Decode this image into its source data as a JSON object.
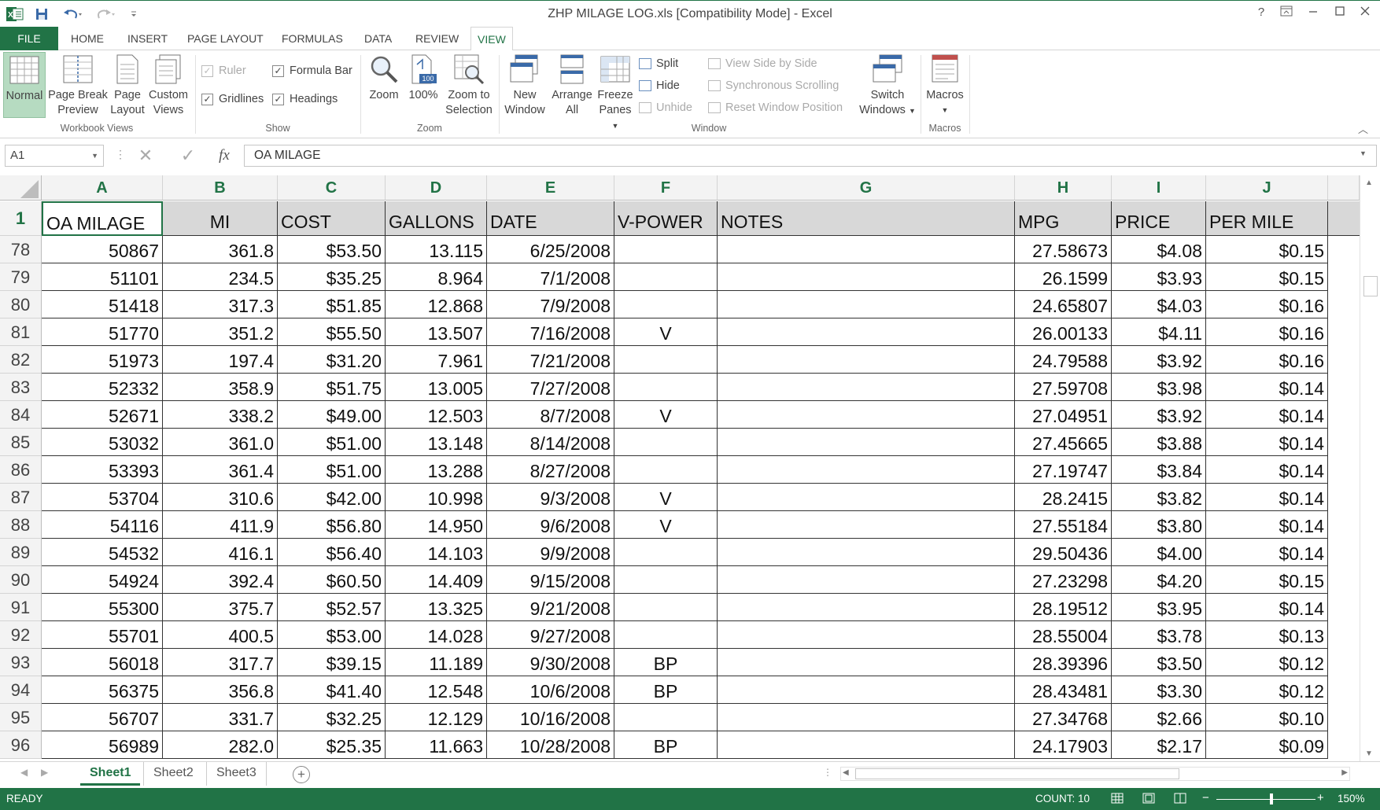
{
  "window": {
    "title": "ZHP MILAGE LOG.xls  [Compatibility Mode] - Excel",
    "help_label": "?",
    "accent": "#217346"
  },
  "ribbon_tabs": [
    "FILE",
    "HOME",
    "INSERT",
    "PAGE LAYOUT",
    "FORMULAS",
    "DATA",
    "REVIEW",
    "VIEW"
  ],
  "active_tab": "VIEW",
  "ribbon": {
    "workbook_views": {
      "label": "Workbook Views",
      "normal": "Normal",
      "page_break_1": "Page Break",
      "page_break_2": "Preview",
      "page_layout_1": "Page",
      "page_layout_2": "Layout",
      "custom_views_1": "Custom",
      "custom_views_2": "Views"
    },
    "show": {
      "label": "Show",
      "ruler": "Ruler",
      "formula_bar": "Formula Bar",
      "gridlines": "Gridlines",
      "headings": "Headings"
    },
    "zoom": {
      "label": "Zoom",
      "zoom": "Zoom",
      "hundred": "100%",
      "zoom_sel_1": "Zoom to",
      "zoom_sel_2": "Selection",
      "hundred_badge": "100"
    },
    "window": {
      "label": "Window",
      "new_window_1": "New",
      "new_window_2": "Window",
      "arrange_all_1": "Arrange",
      "arrange_all_2": "All",
      "freeze_1": "Freeze",
      "freeze_2": "Panes",
      "split": "Split",
      "hide": "Hide",
      "unhide": "Unhide",
      "view_side": "View Side by Side",
      "sync_scroll": "Synchronous Scrolling",
      "reset_pos": "Reset Window Position",
      "switch_1": "Switch",
      "switch_2": "Windows"
    },
    "macros": {
      "label": "Macros",
      "macros": "Macros"
    }
  },
  "formula_bar": {
    "name_box": "A1",
    "fx": "fx",
    "content": "OA MILAGE"
  },
  "columns": [
    "A",
    "B",
    "C",
    "D",
    "E",
    "F",
    "G",
    "H",
    "I",
    "J"
  ],
  "header_row": {
    "row_number": "1",
    "cells": [
      "OA MILAGE",
      "MI",
      "COST",
      "GALLONS",
      "DATE",
      "V-POWER",
      "NOTES",
      "MPG",
      "PRICE",
      "PER MILE"
    ]
  },
  "rows": [
    {
      "n": "78",
      "a": "50867",
      "b": "361.8",
      "c": "$53.50",
      "d": "13.115",
      "e": "6/25/2008",
      "f": "",
      "g": "",
      "h": "27.58673",
      "i": "$4.08",
      "j": "$0.15"
    },
    {
      "n": "79",
      "a": "51101",
      "b": "234.5",
      "c": "$35.25",
      "d": "8.964",
      "e": "7/1/2008",
      "f": "",
      "g": "",
      "h": "26.1599",
      "i": "$3.93",
      "j": "$0.15"
    },
    {
      "n": "80",
      "a": "51418",
      "b": "317.3",
      "c": "$51.85",
      "d": "12.868",
      "e": "7/9/2008",
      "f": "",
      "g": "",
      "h": "24.65807",
      "i": "$4.03",
      "j": "$0.16"
    },
    {
      "n": "81",
      "a": "51770",
      "b": "351.2",
      "c": "$55.50",
      "d": "13.507",
      "e": "7/16/2008",
      "f": "V",
      "g": "",
      "h": "26.00133",
      "i": "$4.11",
      "j": "$0.16"
    },
    {
      "n": "82",
      "a": "51973",
      "b": "197.4",
      "c": "$31.20",
      "d": "7.961",
      "e": "7/21/2008",
      "f": "",
      "g": "",
      "h": "24.79588",
      "i": "$3.92",
      "j": "$0.16"
    },
    {
      "n": "83",
      "a": "52332",
      "b": "358.9",
      "c": "$51.75",
      "d": "13.005",
      "e": "7/27/2008",
      "f": "",
      "g": "",
      "h": "27.59708",
      "i": "$3.98",
      "j": "$0.14"
    },
    {
      "n": "84",
      "a": "52671",
      "b": "338.2",
      "c": "$49.00",
      "d": "12.503",
      "e": "8/7/2008",
      "f": "V",
      "g": "",
      "h": "27.04951",
      "i": "$3.92",
      "j": "$0.14"
    },
    {
      "n": "85",
      "a": "53032",
      "b": "361.0",
      "c": "$51.00",
      "d": "13.148",
      "e": "8/14/2008",
      "f": "",
      "g": "",
      "h": "27.45665",
      "i": "$3.88",
      "j": "$0.14"
    },
    {
      "n": "86",
      "a": "53393",
      "b": "361.4",
      "c": "$51.00",
      "d": "13.288",
      "e": "8/27/2008",
      "f": "",
      "g": "",
      "h": "27.19747",
      "i": "$3.84",
      "j": "$0.14"
    },
    {
      "n": "87",
      "a": "53704",
      "b": "310.6",
      "c": "$42.00",
      "d": "10.998",
      "e": "9/3/2008",
      "f": "V",
      "g": "",
      "h": "28.2415",
      "i": "$3.82",
      "j": "$0.14"
    },
    {
      "n": "88",
      "a": "54116",
      "b": "411.9",
      "c": "$56.80",
      "d": "14.950",
      "e": "9/6/2008",
      "f": "V",
      "g": "",
      "h": "27.55184",
      "i": "$3.80",
      "j": "$0.14"
    },
    {
      "n": "89",
      "a": "54532",
      "b": "416.1",
      "c": "$56.40",
      "d": "14.103",
      "e": "9/9/2008",
      "f": "",
      "g": "",
      "h": "29.50436",
      "i": "$4.00",
      "j": "$0.14"
    },
    {
      "n": "90",
      "a": "54924",
      "b": "392.4",
      "c": "$60.50",
      "d": "14.409",
      "e": "9/15/2008",
      "f": "",
      "g": "",
      "h": "27.23298",
      "i": "$4.20",
      "j": "$0.15"
    },
    {
      "n": "91",
      "a": "55300",
      "b": "375.7",
      "c": "$52.57",
      "d": "13.325",
      "e": "9/21/2008",
      "f": "",
      "g": "",
      "h": "28.19512",
      "i": "$3.95",
      "j": "$0.14"
    },
    {
      "n": "92",
      "a": "55701",
      "b": "400.5",
      "c": "$53.00",
      "d": "14.028",
      "e": "9/27/2008",
      "f": "",
      "g": "",
      "h": "28.55004",
      "i": "$3.78",
      "j": "$0.13"
    },
    {
      "n": "93",
      "a": "56018",
      "b": "317.7",
      "c": "$39.15",
      "d": "11.189",
      "e": "9/30/2008",
      "f": "BP",
      "g": "",
      "h": "28.39396",
      "i": "$3.50",
      "j": "$0.12"
    },
    {
      "n": "94",
      "a": "56375",
      "b": "356.8",
      "c": "$41.40",
      "d": "12.548",
      "e": "10/6/2008",
      "f": "BP",
      "g": "",
      "h": "28.43481",
      "i": "$3.30",
      "j": "$0.12"
    },
    {
      "n": "95",
      "a": "56707",
      "b": "331.7",
      "c": "$32.25",
      "d": "12.129",
      "e": "10/16/2008",
      "f": "",
      "g": "",
      "h": "27.34768",
      "i": "$2.66",
      "j": "$0.10"
    },
    {
      "n": "96",
      "a": "56989",
      "b": "282.0",
      "c": "$25.35",
      "d": "11.663",
      "e": "10/28/2008",
      "f": "BP",
      "g": "",
      "h": "24.17903",
      "i": "$2.17",
      "j": "$0.09"
    }
  ],
  "sheet_tabs": [
    "Sheet1",
    "Sheet2",
    "Sheet3"
  ],
  "active_sheet": "Sheet1",
  "status": {
    "ready": "READY",
    "count": "COUNT: 10",
    "zoom": "150%",
    "zoom_minus": "−",
    "zoom_plus": "+"
  }
}
